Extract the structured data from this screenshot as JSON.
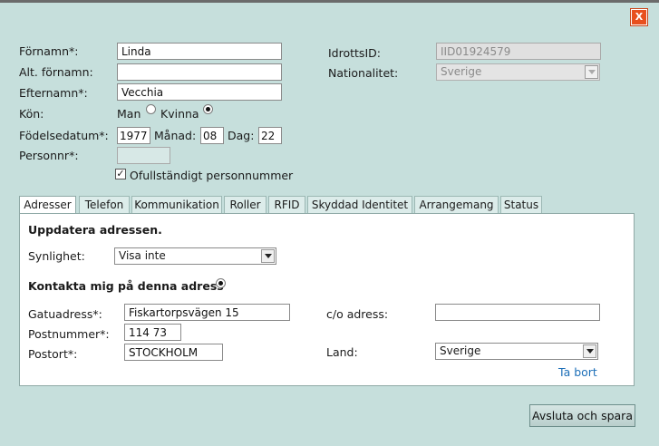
{
  "dialog": {
    "close_label": "X"
  },
  "person": {
    "firstname_label": "Förnamn*:",
    "firstname_value": "Linda",
    "altname_label": "Alt. förnamn:",
    "altname_value": "",
    "lastname_label": "Efternamn*:",
    "lastname_value": "Vecchia",
    "gender_label": "Kön:",
    "gender_options": [
      "Man",
      "Kvinna"
    ],
    "gender_selected": "Kvinna",
    "birth_label": "Födelsedatum*:",
    "birth_year": "1977",
    "month_label": "Månad:",
    "birth_month": "08",
    "day_label": "Dag:",
    "birth_day": "22",
    "personnr_label": "Personnr*:",
    "personnr_value": "",
    "incomplete_label": "Ofullständigt personnummer",
    "incomplete_checked": true,
    "idrottsid_label": "IdrottsID:",
    "idrottsid_value": "IID01924579",
    "nationality_label": "Nationalitet:",
    "nationality_value": "Sverige"
  },
  "tabs": [
    {
      "label": "Adresser",
      "active": true
    },
    {
      "label": "Telefon"
    },
    {
      "label": "Kommunikation"
    },
    {
      "label": "Roller"
    },
    {
      "label": "RFID"
    },
    {
      "label": "Skyddad Identitet"
    },
    {
      "label": "Arrangemang"
    },
    {
      "label": "Status"
    }
  ],
  "address": {
    "heading": "Uppdatera adressen.",
    "visibility_label": "Synlighet:",
    "visibility_value": "Visa inte",
    "contact_label": "Kontakta mig på denna adress",
    "contact_selected": true,
    "street_label": "Gatuadress*:",
    "street_value": "Fiskartorpsvägen 15",
    "co_label": "c/o adress:",
    "co_value": "",
    "zip_label": "Postnummer*:",
    "zip_value": "114 73",
    "city_label": "Postort*:",
    "city_value": "STOCKHOLM",
    "country_label": "Land:",
    "country_value": "Sverige",
    "remove_link": "Ta bort"
  },
  "footer": {
    "save_label": "Avsluta och spara"
  },
  "colors": {
    "background": "#c6dfdc",
    "close": "#e8501e",
    "link": "#1d6fb8"
  }
}
